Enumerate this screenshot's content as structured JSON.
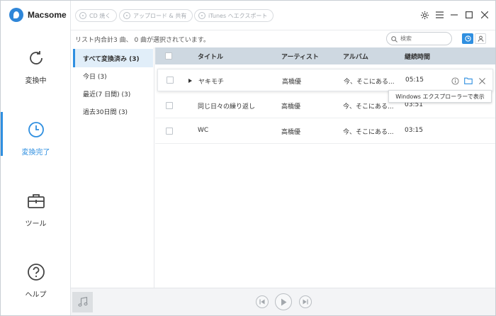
{
  "app": {
    "name": "Macsome"
  },
  "toolbar": {
    "burn_cd": "CD 焼く",
    "upload_share": "アップロード & 共有",
    "itunes_export": "iTunes へエクスポート"
  },
  "nav": [
    {
      "label": "変換中",
      "icon": "refresh-icon"
    },
    {
      "label": "変換完了",
      "icon": "clock-icon"
    },
    {
      "label": "ツール",
      "icon": "toolbox-icon"
    },
    {
      "label": "ヘルプ",
      "icon": "help-icon"
    }
  ],
  "info": {
    "summary": "リスト内合計3 曲、 0 曲が選択されています。"
  },
  "search": {
    "placeholder": "検索"
  },
  "filters": [
    {
      "label": "すべて変換済み (3)"
    },
    {
      "label": "今日 (3)"
    },
    {
      "label": "最近(7 日間) (3)"
    },
    {
      "label": "過去30日間 (3)"
    }
  ],
  "table": {
    "columns": {
      "title": "タイトル",
      "artist": "アーティスト",
      "album": "アルバム",
      "duration": "継続時間"
    },
    "rows": [
      {
        "title": "ヤキモチ",
        "artist": "高橋優",
        "album": "今、そこにある...",
        "duration": "05:15"
      },
      {
        "title": "同じ日々の繰り返し",
        "artist": "高橋優",
        "album": "今、そこにある...",
        "duration": "03:51"
      },
      {
        "title": "WC",
        "artist": "高橋優",
        "album": "今、そこにある...",
        "duration": "03:15"
      }
    ]
  },
  "tooltip": {
    "text": "Windows エクスプローラーで表示"
  },
  "colors": {
    "accent": "#2f8fe0",
    "header_bg": "#ced8e1",
    "active_filter_bg": "#e1eef9"
  }
}
